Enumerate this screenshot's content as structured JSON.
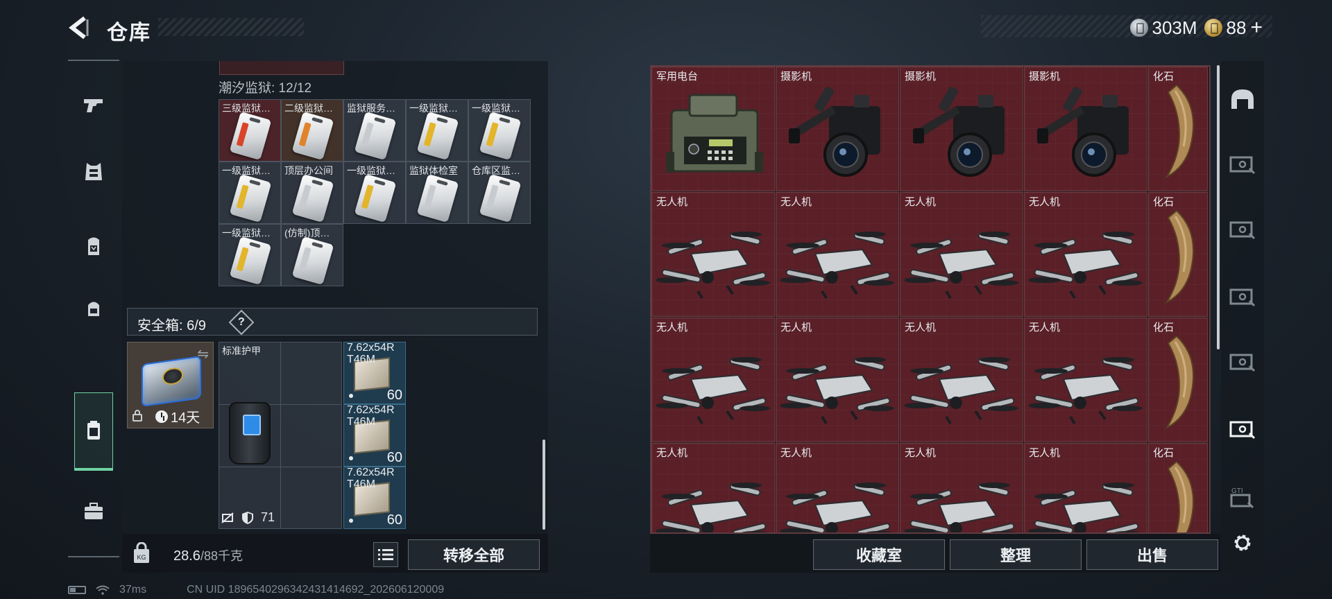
{
  "header": {
    "title": "仓库",
    "currency": [
      {
        "icon": "silver-coin-icon",
        "value": "303M"
      },
      {
        "icon": "gold-coin-icon",
        "value": "88"
      }
    ],
    "add_symbol": "+"
  },
  "nav_rail": {
    "items": [
      {
        "icon": "pistol-icon",
        "active": false
      },
      {
        "icon": "armor-vest-icon",
        "active": false
      },
      {
        "icon": "backpack-icon",
        "active": false
      },
      {
        "icon": "chest-rig-icon",
        "active": false
      },
      {
        "icon": "safe-box-icon",
        "active": true
      },
      {
        "icon": "toolbox-icon",
        "active": false
      }
    ]
  },
  "storage": {
    "prison_label": "潮汐监狱: 12/12",
    "keycards": [
      {
        "label": "三级监狱…",
        "stripe": "#d8452a",
        "bg": "red"
      },
      {
        "label": "二级监狱…",
        "stripe": "#e0832c",
        "bg": "brown"
      },
      {
        "label": "监狱服务…",
        "stripe": "#c7cbcf",
        "bg": ""
      },
      {
        "label": "一级监狱…",
        "stripe": "#e2b52a",
        "bg": ""
      },
      {
        "label": "一级监狱…",
        "stripe": "#e2b52a",
        "bg": ""
      },
      {
        "label": "一级监狱…",
        "stripe": "#e2b52a",
        "bg": ""
      },
      {
        "label": "顶层办公间",
        "stripe": "#c7cbcf",
        "bg": ""
      },
      {
        "label": "一级监狱…",
        "stripe": "#e2b52a",
        "bg": ""
      },
      {
        "label": "监狱体检室",
        "stripe": "#c7cbcf",
        "bg": ""
      },
      {
        "label": "仓库区监…",
        "stripe": "#c7cbcf",
        "bg": ""
      },
      {
        "label": "一级监狱…",
        "stripe": "#e2b52a",
        "bg": ""
      },
      {
        "label": "(仿制)顶…",
        "stripe": "#c7cbcf",
        "bg": ""
      }
    ],
    "safe_label": "安全箱: 6/9",
    "help_symbol": "?",
    "safe_box": {
      "swap_symbol": "⇋",
      "days": "14天"
    },
    "armor": {
      "label": "标准护甲",
      "durability": "71"
    },
    "ammo": [
      {
        "label": "7.62x54R T46M",
        "qty": "60"
      },
      {
        "label": "7.62x54R T46M",
        "qty": "60"
      },
      {
        "label": "7.62x54R T46M",
        "qty": "60"
      }
    ]
  },
  "footer_left": {
    "weight_value": "28.6",
    "weight_max": "/88千克",
    "transfer_label": "转移全部"
  },
  "collection": {
    "rows": [
      [
        {
          "label": "军用电台",
          "art": "radio"
        },
        {
          "label": "摄影机",
          "art": "camera"
        },
        {
          "label": "摄影机",
          "art": "camera"
        },
        {
          "label": "摄影机",
          "art": "camera"
        },
        {
          "label": "化石",
          "art": "fossil"
        }
      ],
      [
        {
          "label": "无人机",
          "art": "drone"
        },
        {
          "label": "无人机",
          "art": "drone"
        },
        {
          "label": "无人机",
          "art": "drone"
        },
        {
          "label": "无人机",
          "art": "drone"
        },
        {
          "label": "化石",
          "art": "fossil"
        }
      ],
      [
        {
          "label": "无人机",
          "art": "drone"
        },
        {
          "label": "无人机",
          "art": "drone"
        },
        {
          "label": "无人机",
          "art": "drone"
        },
        {
          "label": "无人机",
          "art": "drone"
        },
        {
          "label": "化石",
          "art": "fossil"
        }
      ],
      [
        {
          "label": "无人机",
          "art": "drone"
        },
        {
          "label": "无人机",
          "art": "drone"
        },
        {
          "label": "无人机",
          "art": "drone"
        },
        {
          "label": "无人机",
          "art": "drone"
        },
        {
          "label": "化石",
          "art": "fossil"
        }
      ]
    ]
  },
  "footer_right": {
    "buttons": [
      "收藏室",
      "整理",
      "出售"
    ]
  },
  "right_rail": {
    "items": [
      "dome-icon",
      "collection-card-icon",
      "collection-card-icon",
      "collection-card-icon",
      "collection-card-icon",
      "collection-card-selected-icon",
      "gti-card-icon",
      "settings-gear-icon"
    ]
  },
  "status_bar": {
    "ping": "37ms",
    "uid": "CN UID 1896540296342431414692_202606120009"
  },
  "colors": {
    "accent": "#6fd2a4",
    "collection_bg": "#5a1f27",
    "ammo_bg": "#285a78"
  }
}
